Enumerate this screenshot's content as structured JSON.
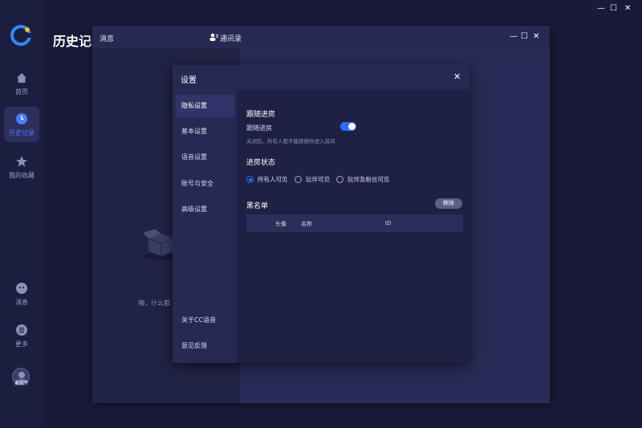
{
  "window_controls": {
    "minimize": "—",
    "maximize": "☐",
    "close": "✕"
  },
  "sidebar": {
    "items": [
      {
        "label": "首页",
        "icon": "home-icon",
        "active": false
      },
      {
        "label": "历史记录",
        "icon": "clock-icon",
        "active": true
      },
      {
        "label": "我的收藏",
        "icon": "star-icon",
        "active": false
      }
    ],
    "bottom_items": [
      {
        "label": "消息",
        "icon": "chat-icon"
      },
      {
        "label": "更多",
        "icon": "menu-icon"
      }
    ],
    "avatar_name": "麦坨牛"
  },
  "page": {
    "title": "历史记录"
  },
  "message_window": {
    "tab_messages": "消息",
    "tab_contacts": "通讯录",
    "empty_text": "噢，什么都"
  },
  "settings": {
    "title": "设置",
    "nav": [
      "隐私设置",
      "基本设置",
      "语音设置",
      "账号与安全",
      "高级设置"
    ],
    "nav_bottom": [
      "关于CC语音",
      "意见反馈"
    ],
    "follow_section_title": "跟随进房",
    "follow_label": "跟随进房",
    "follow_enabled": true,
    "follow_hint": "关闭后，所有人都不能跟随你进入房间",
    "status_section_title": "进房状态",
    "status_options": [
      "所有人可见",
      "玩伴可见",
      "玩伴及粉丝可见"
    ],
    "status_selected": "所有人可见",
    "blacklist_title": "黑名单",
    "remove_button": "移除",
    "blacklist_columns": [
      "头像",
      "名称",
      "ID"
    ]
  },
  "colors": {
    "accent": "#2f6bff",
    "sidebar_bg": "#1c1e40",
    "dialog_bg": "#1e2144"
  }
}
